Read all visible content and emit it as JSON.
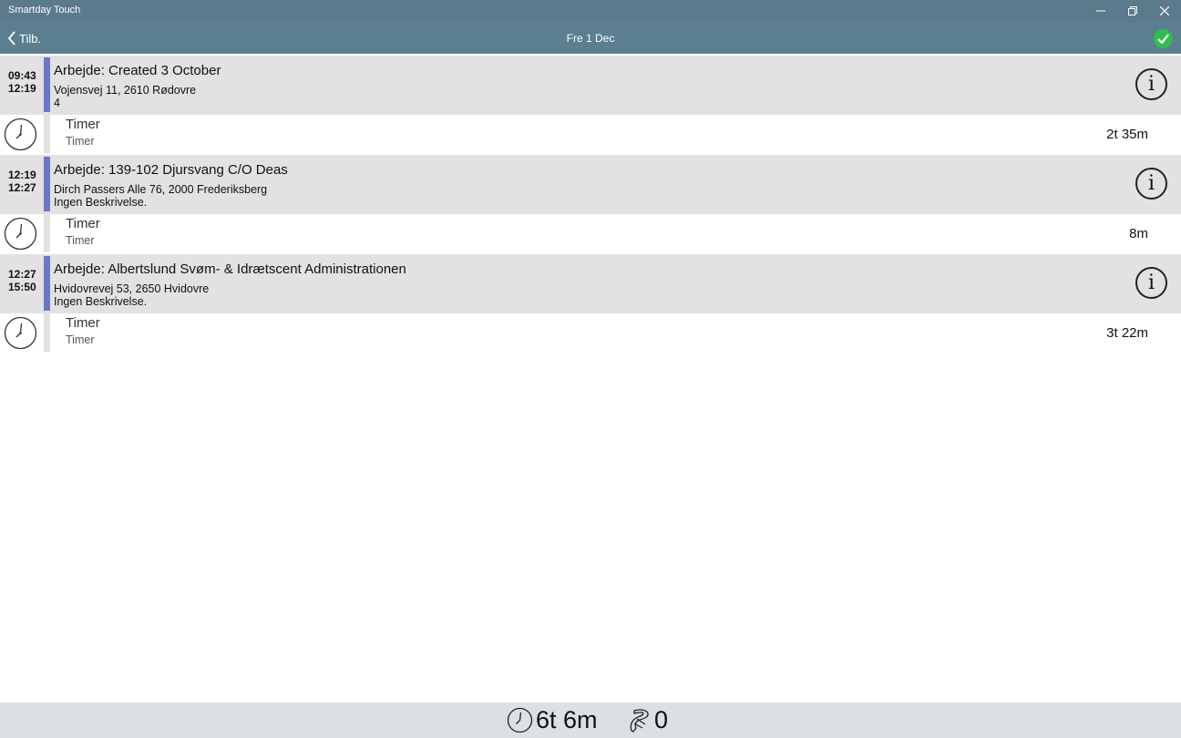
{
  "window": {
    "title": "Smartday Touch",
    "icons": {
      "minimize": "minimize-icon",
      "maximize": "restore-icon",
      "close": "close-icon"
    }
  },
  "navbar": {
    "back_label": "Tilb.",
    "title": "Fre 1 Dec",
    "confirm_icon": "checkmark-icon",
    "accent": "#5b7f90",
    "confirm_color": "#2fbf4b"
  },
  "jobs": [
    {
      "start": "09:43",
      "end": "12:19",
      "title": "Arbejde: Created 3 October",
      "address": "Vojensvej 11, 2610 Rødovre",
      "description": "4",
      "info_label": "i",
      "entry": {
        "title": "Timer",
        "subtitle": "Timer",
        "duration": "2t 35m"
      }
    },
    {
      "start": "12:19",
      "end": "12:27",
      "title": "Arbejde: 139-102 Djursvang C/O Deas",
      "address": "Dirch Passers Alle 76, 2000 Frederiksberg",
      "description": "Ingen Beskrivelse.",
      "info_label": "i",
      "entry": {
        "title": "Timer",
        "subtitle": "Timer",
        "duration": "8m"
      }
    },
    {
      "start": "12:27",
      "end": "15:50",
      "title": "Arbejde: Albertslund Svøm- & Idrætscent Administrationen",
      "address": "Hvidovrevej 53, 2650 Hvidovre",
      "description": "Ingen Beskrivelse.",
      "info_label": "i",
      "entry": {
        "title": "Timer",
        "subtitle": "Timer",
        "duration": "3t 22m"
      }
    }
  ],
  "footer": {
    "total_time": "6t 6m",
    "material_count": "0",
    "icons": {
      "time": "clock-icon",
      "material": "material-icon"
    }
  },
  "colors": {
    "job_bar": "#6977c9",
    "job_bg": "#e2e2e2"
  }
}
